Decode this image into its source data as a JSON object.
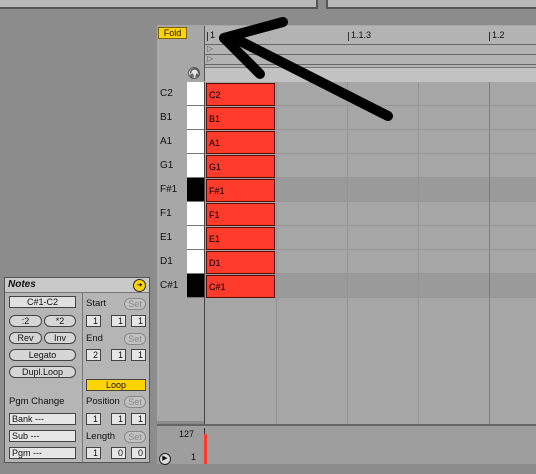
{
  "fold_label": "Fold",
  "ruler": {
    "labels": [
      "1",
      "1.1.3",
      "1.2"
    ]
  },
  "headphone_glyph": "🎧",
  "keys": [
    {
      "label": "C2",
      "color": "white"
    },
    {
      "label": "B1",
      "color": "white"
    },
    {
      "label": "A1",
      "color": "white"
    },
    {
      "label": "G1",
      "color": "white"
    },
    {
      "label": "F#1",
      "color": "black"
    },
    {
      "label": "F1",
      "color": "white"
    },
    {
      "label": "E1",
      "color": "white"
    },
    {
      "label": "D1",
      "color": "white"
    },
    {
      "label": "C#1",
      "color": "black"
    }
  ],
  "notes_grid": [
    "C2",
    "B1",
    "A1",
    "G1",
    "F#1",
    "F1",
    "E1",
    "D1",
    "C#1"
  ],
  "velocity": {
    "max_label": "127",
    "min_label": "1"
  },
  "notes_panel": {
    "title": "Notes",
    "range": "C#1-C2",
    "div2": ":2",
    "mul2": "*2",
    "rev": "Rev",
    "inv": "Inv",
    "legato": "Legato",
    "dupl_loop": "Dupl.Loop",
    "pgm_change": "Pgm Change",
    "bank": "Bank ---",
    "sub": "Sub ---",
    "pgm": "Pgm ---",
    "start_label": "Start",
    "end_label": "End",
    "loop_label": "Loop",
    "position_label": "Position",
    "length_label": "Length",
    "set_label": "Set",
    "start": [
      "1",
      "1",
      "1"
    ],
    "end": [
      "2",
      "1",
      "1"
    ],
    "position": [
      "1",
      "1",
      "1"
    ],
    "length": [
      "1",
      "0",
      "0"
    ]
  },
  "colors": {
    "note": "#ff3b2b",
    "accent": "#ffd400"
  }
}
